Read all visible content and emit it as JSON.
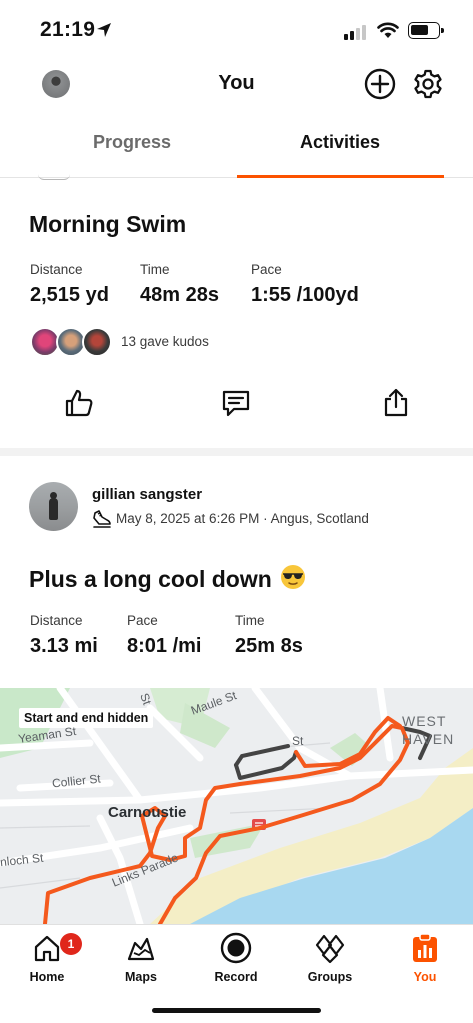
{
  "status_bar": {
    "time": "21:19"
  },
  "header": {
    "title": "You"
  },
  "tabs": [
    {
      "label": "Progress",
      "active": false
    },
    {
      "label": "Activities",
      "active": true
    }
  ],
  "activity1": {
    "title": "Morning Swim",
    "stats": [
      {
        "label": "Distance",
        "value": "2,515 yd"
      },
      {
        "label": "Time",
        "value": "48m 28s"
      },
      {
        "label": "Pace",
        "value": "1:55 /100yd"
      }
    ],
    "kudos_text": "13 gave kudos"
  },
  "activity2": {
    "athlete": "gillian sangster",
    "meta": "May 8, 2025 at 6:26 PM · Angus, Scotland",
    "title": "Plus a long cool down",
    "stats": [
      {
        "label": "Distance",
        "value": "3.13 mi"
      },
      {
        "label": "Pace",
        "value": "8:01 /mi"
      },
      {
        "label": "Time",
        "value": "25m 8s"
      }
    ],
    "map": {
      "badge": "Start and end hidden",
      "town": "Carnoustie",
      "area_lines": [
        "WEST",
        "HAVEN"
      ],
      "streets": [
        "Yeaman St",
        "Collier St",
        "Maule St",
        "Links Parade",
        "nloch St",
        "St",
        "St"
      ]
    }
  },
  "bottom_nav": {
    "items": [
      {
        "label": "Home",
        "icon": "home-icon",
        "badge": "1",
        "active": false
      },
      {
        "label": "Maps",
        "icon": "maps-icon",
        "active": false
      },
      {
        "label": "Record",
        "icon": "record-icon",
        "active": false
      },
      {
        "label": "Groups",
        "icon": "groups-icon",
        "active": false
      },
      {
        "label": "You",
        "icon": "you-icon",
        "active": true
      }
    ]
  },
  "colors": {
    "accent": "#fc5200",
    "route": "#f4591d",
    "hidden_route": "#444444",
    "water": "#a8d8f0",
    "badge": "#e0271b"
  }
}
